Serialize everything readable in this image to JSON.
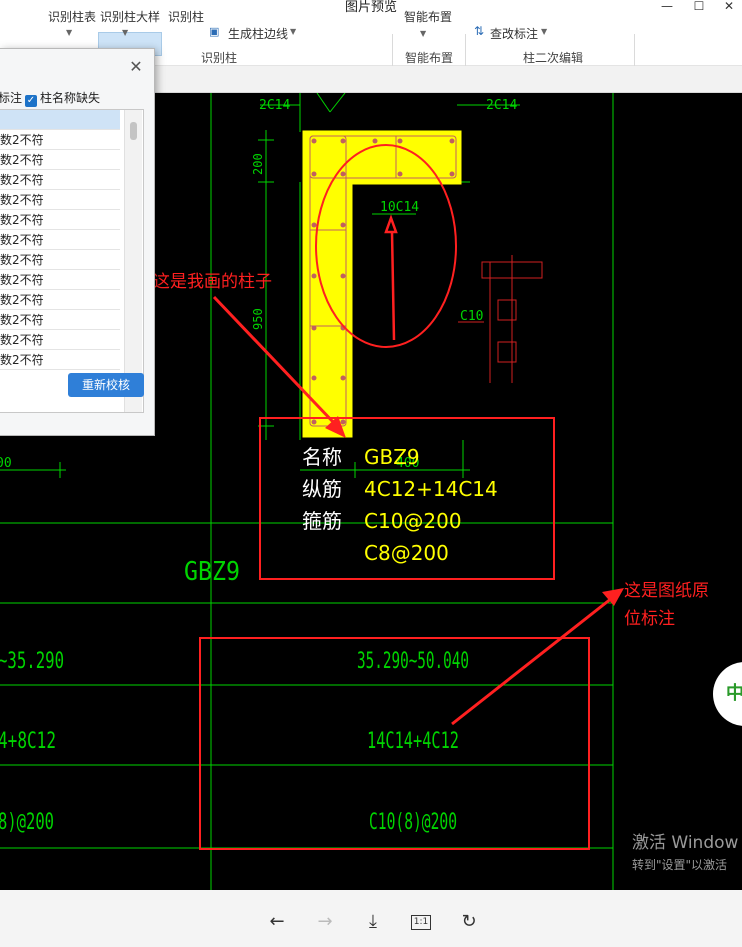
{
  "window": {
    "title": "图片预览",
    "min_glyph": "—",
    "max_glyph": "☐",
    "close_glyph": "✕"
  },
  "ribbon": {
    "top_items": [
      "识别柱表",
      "识别柱大样",
      "识别柱"
    ],
    "gen_edge": "生成柱边线",
    "smart_place": "智能布置",
    "check_annot": "查改标注",
    "group_labels": [
      "识别柱",
      "智能布置",
      "柱二次编辑"
    ]
  },
  "dialog": {
    "close": "✕",
    "opt1": "标注",
    "opt2": "柱名称缺失",
    "rows": [
      "",
      "数2不符",
      "数2不符",
      "数2不符",
      "数2不符",
      "数2不符",
      "数2不符",
      "数2不符",
      "数2不符",
      "数2不符",
      "数2不符",
      "数2不符",
      "数2不符"
    ],
    "recheck_button": "重新校核"
  },
  "drawing": {
    "dim_top_left": "2C14",
    "dim_top_right": "2C14",
    "dim_200": "200",
    "dim_950": "950",
    "inner_rebar": "10C14",
    "side_label": "C10",
    "left_dim": "00",
    "mid_dim": "400",
    "note_mine": "这是我画的柱子",
    "note_orig_line1": "这是图纸原",
    "note_orig_line2": "位标注",
    "info": {
      "name_label": "名称",
      "name_value": "GBZ9",
      "long_label": "纵筋",
      "long_value": "4C12+14C14",
      "stir_label": "箍筋",
      "stir_value1": "C10@200",
      "stir_value2": "C8@200"
    },
    "table_title": "GBZ9",
    "table_rows": [
      {
        "left": "~35.290",
        "right": "35.290~50.040"
      },
      {
        "left": "4+8C12",
        "right": "14C14+4C12"
      },
      {
        "left": "8)@200",
        "right": "C10(8)@200"
      }
    ],
    "badge_char": "中",
    "watermark_line1": "激活 Window",
    "watermark_line2": "转到\"设置\"以激活"
  },
  "bottom_bar": {
    "prev": "←",
    "next": "→",
    "download": "⤓",
    "actual_size": "1:1",
    "rotate": "↻"
  },
  "colors": {
    "canvas": "#000000",
    "cad_green": "#00e000",
    "column_yellow": "#ffff00",
    "annot_red": "#ff2020",
    "text_yellow": "#ffff00",
    "accent_blue": "#2f7fd8"
  }
}
